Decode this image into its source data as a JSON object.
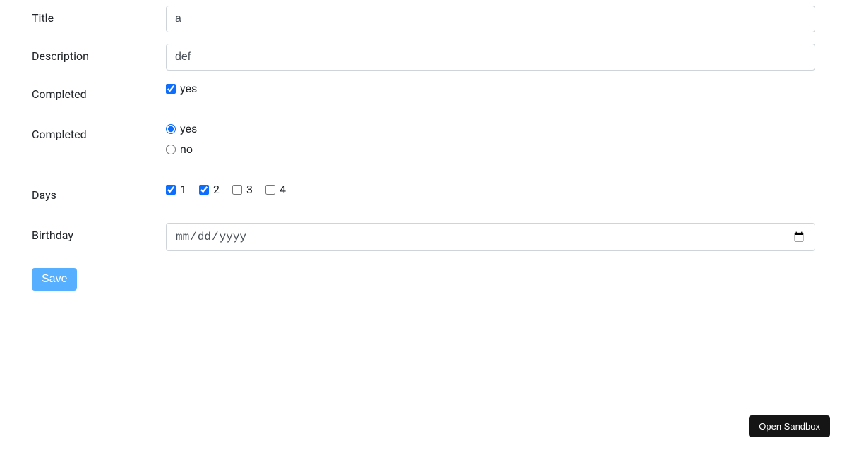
{
  "fields": {
    "title": {
      "label": "Title",
      "value": "a"
    },
    "description": {
      "label": "Description",
      "value": "def"
    },
    "completed_checkbox": {
      "label": "Completed",
      "option_label": "yes",
      "checked": true
    },
    "completed_radio": {
      "label": "Completed",
      "options": [
        {
          "label": "yes",
          "value": "yes",
          "checked": true
        },
        {
          "label": "no",
          "value": "no",
          "checked": false
        }
      ]
    },
    "days": {
      "label": "Days",
      "options": [
        {
          "label": "1",
          "checked": true
        },
        {
          "label": "2",
          "checked": true
        },
        {
          "label": "3",
          "checked": false
        },
        {
          "label": "4",
          "checked": false
        }
      ]
    },
    "birthday": {
      "label": "Birthday",
      "placeholder": "mm/dd/yyyy",
      "value": ""
    }
  },
  "buttons": {
    "save": "Save",
    "open_sandbox": "Open Sandbox"
  }
}
